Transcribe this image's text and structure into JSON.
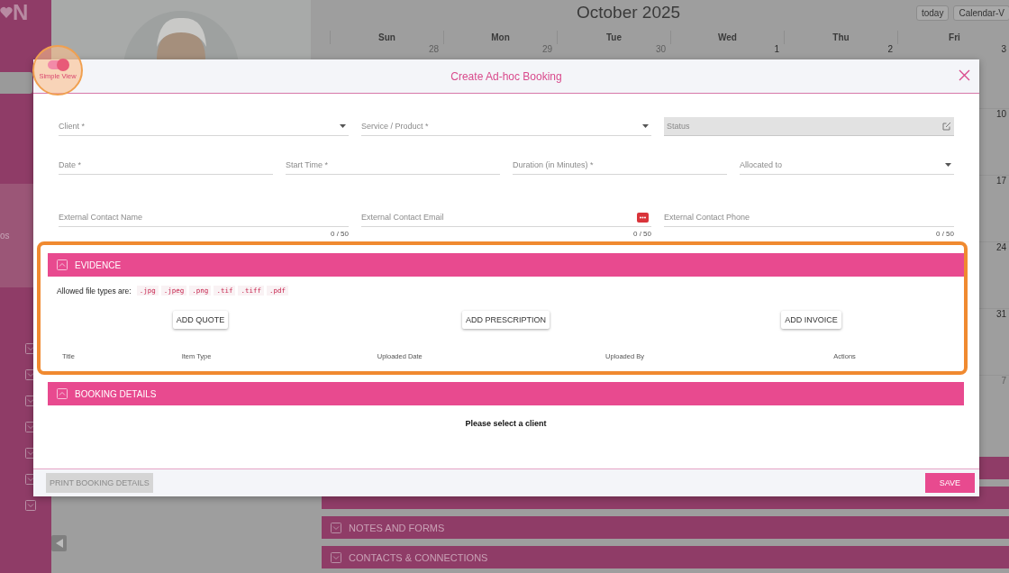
{
  "sidebar": {
    "logo": "N",
    "label": "os"
  },
  "calendar": {
    "title": "October 2025",
    "buttons": [
      "today",
      "Calendar-V"
    ],
    "days": [
      {
        "name": "Sun",
        "date": "28",
        "other_month": true
      },
      {
        "name": "Mon",
        "date": "29",
        "other_month": true
      },
      {
        "name": "Tue",
        "date": "30",
        "other_month": true
      },
      {
        "name": "Wed",
        "date": "1",
        "other_month": false
      },
      {
        "name": "Thu",
        "date": "2",
        "other_month": false
      },
      {
        "name": "Fri",
        "date": "3",
        "other_month": false
      }
    ],
    "week_dates": [
      {
        "date": "10",
        "other_month": false
      },
      {
        "date": "17",
        "other_month": false
      },
      {
        "date": "24",
        "other_month": false
      },
      {
        "date": "31",
        "other_month": false
      },
      {
        "date": "7",
        "other_month": true
      }
    ]
  },
  "sections": [
    {
      "title": "NOTES AND FORMS",
      "expanded": false
    },
    {
      "title": "CONTACTS & CONNECTIONS",
      "expanded": false
    }
  ],
  "modal": {
    "title": "Create Ad-hoc Booking",
    "simple_view": {
      "label": "Simple View",
      "on": true,
      "highlighted": true
    },
    "field_rows": [
      [
        {
          "label": "Client *",
          "kind": "dropdown"
        },
        {
          "label": "Service / Product *",
          "kind": "dropdown"
        },
        {
          "label": "Status",
          "kind": "status"
        }
      ],
      [
        {
          "label": "Date *",
          "kind": "text"
        },
        {
          "label": "Start Time *",
          "kind": "text"
        },
        {
          "label": "Duration (in Minutes) *",
          "kind": "text"
        },
        {
          "label": "Allocated to",
          "kind": "dropdown"
        }
      ],
      [
        {
          "label": "External Contact Name",
          "kind": "counted",
          "counter": "0 / 50"
        },
        {
          "label": "External Contact Email",
          "kind": "counted",
          "counter": "0 / 50"
        },
        {
          "label": "External Contact Phone",
          "kind": "counted",
          "counter": "0 / 50"
        }
      ]
    ],
    "evidence": {
      "title": "EVIDENCE",
      "expanded": true,
      "highlighted": true,
      "allowed_label": "Allowed file types are:",
      "file_types": [
        ".jpg",
        ".jpeg",
        ".png",
        ".tif",
        ".tiff",
        ".pdf"
      ],
      "buttons": [
        "ADD QUOTE",
        "ADD PRESCRIPTION",
        "ADD INVOICE"
      ],
      "columns": [
        "Title",
        "Item Type",
        "Uploaded Date",
        "Uploaded By",
        "Actions"
      ]
    },
    "booking_details": {
      "title": "BOOKING DETAILS",
      "expanded": true,
      "message": "Please select a client"
    },
    "footer": {
      "print": {
        "label": "PRINT BOOKING DETAILS",
        "disabled": true
      },
      "save": "SAVE"
    }
  }
}
